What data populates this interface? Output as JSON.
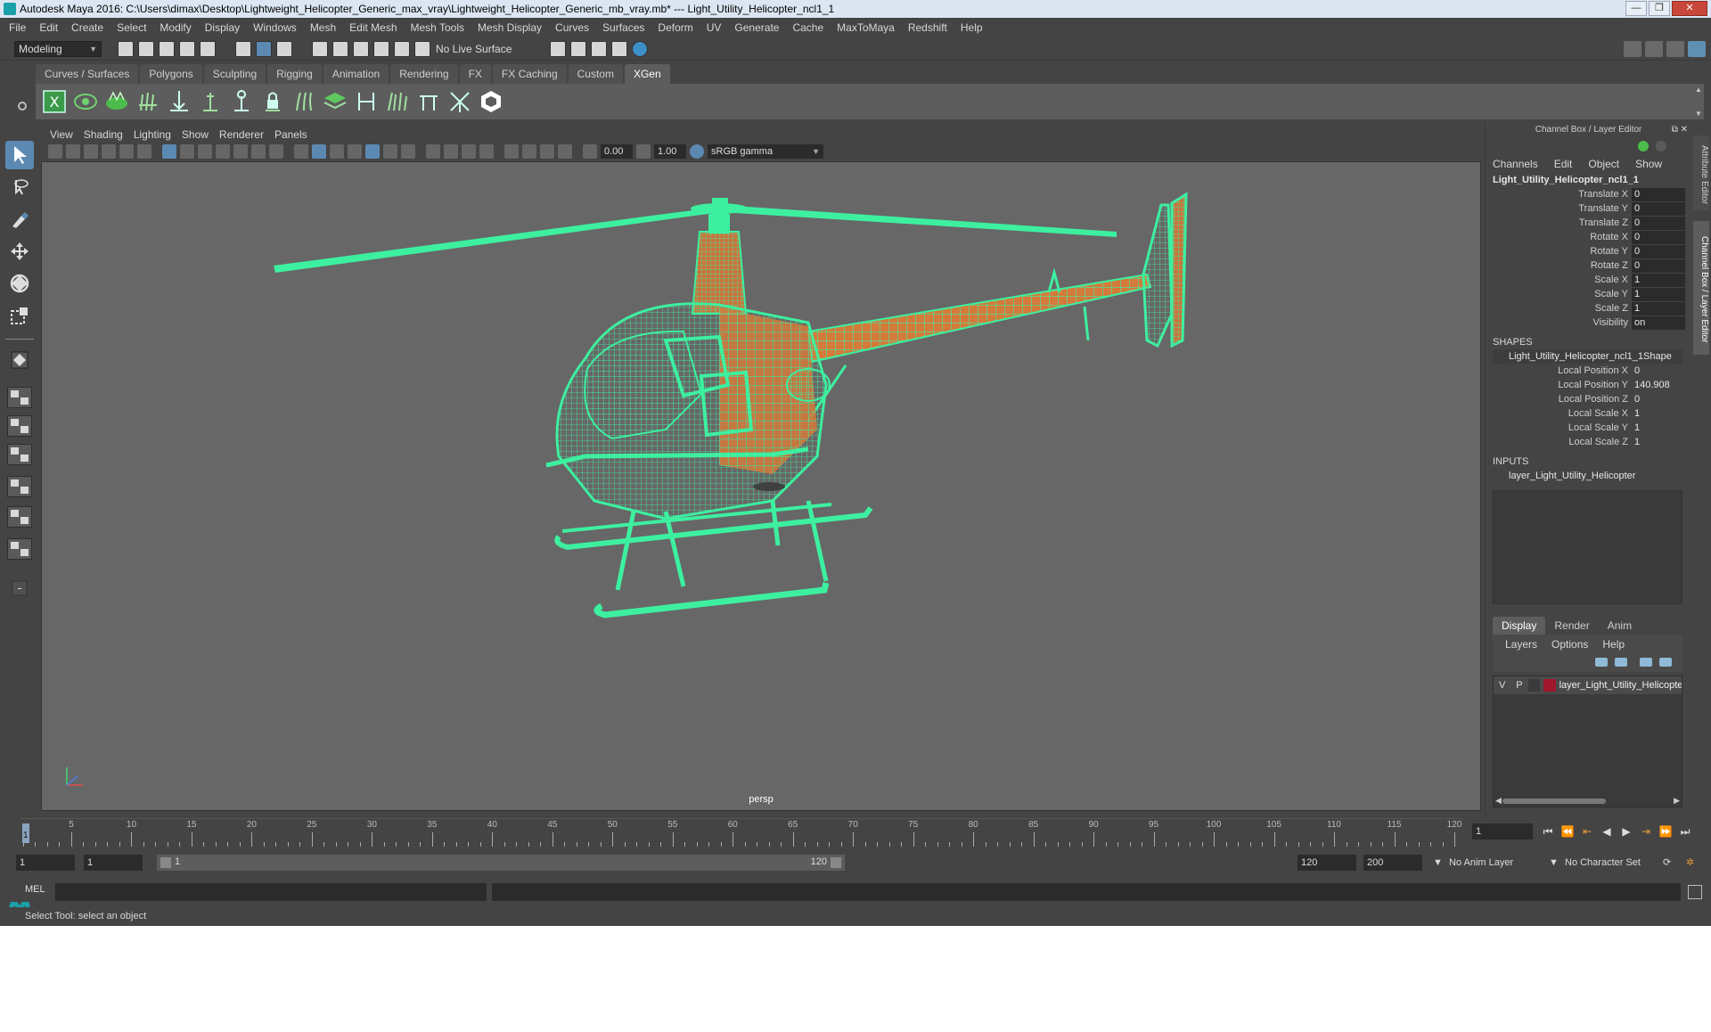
{
  "window": {
    "title": "Autodesk Maya 2016: C:\\Users\\dimax\\Desktop\\Lightweight_Helicopter_Generic_max_vray\\Lightweight_Helicopter_Generic_mb_vray.mb*   ---   Light_Utility_Helicopter_ncl1_1",
    "minimize": "—",
    "maximize": "❐",
    "close": "✕"
  },
  "menubar": [
    "File",
    "Edit",
    "Create",
    "Select",
    "Modify",
    "Display",
    "Windows",
    "Mesh",
    "Edit Mesh",
    "Mesh Tools",
    "Mesh Display",
    "Curves",
    "Surfaces",
    "Deform",
    "UV",
    "Generate",
    "Cache",
    "MaxToMaya",
    "Redshift",
    "Help"
  ],
  "statusline": {
    "mode": "Modeling",
    "live_surface": "No Live Surface"
  },
  "shelf_tabs": [
    {
      "label": "Curves / Surfaces",
      "active": false
    },
    {
      "label": "Polygons",
      "active": false
    },
    {
      "label": "Sculpting",
      "active": false
    },
    {
      "label": "Rigging",
      "active": false
    },
    {
      "label": "Animation",
      "active": false
    },
    {
      "label": "Rendering",
      "active": false
    },
    {
      "label": "FX",
      "active": false
    },
    {
      "label": "FX Caching",
      "active": false
    },
    {
      "label": "Custom",
      "active": false
    },
    {
      "label": "XGen",
      "active": true
    }
  ],
  "viewport": {
    "menu": [
      "View",
      "Shading",
      "Lighting",
      "Show",
      "Renderer",
      "Panels"
    ],
    "exposure": "0.00",
    "gamma_value": "1.00",
    "color_space": "sRGB gamma",
    "camera": "persp",
    "wire_color": "#3df0a0",
    "surface_color": "#d47a3a",
    "bg_color": "#676767"
  },
  "channel_box": {
    "title": "Channel Box / Layer Editor",
    "menu": [
      "Channels",
      "Edit",
      "Object",
      "Show"
    ],
    "object_name": "Light_Utility_Helicopter_ncl1_1",
    "channels": [
      {
        "label": "Translate X",
        "value": "0"
      },
      {
        "label": "Translate Y",
        "value": "0"
      },
      {
        "label": "Translate Z",
        "value": "0"
      },
      {
        "label": "Rotate X",
        "value": "0"
      },
      {
        "label": "Rotate Y",
        "value": "0"
      },
      {
        "label": "Rotate Z",
        "value": "0"
      },
      {
        "label": "Scale X",
        "value": "1"
      },
      {
        "label": "Scale Y",
        "value": "1"
      },
      {
        "label": "Scale Z",
        "value": "1"
      },
      {
        "label": "Visibility",
        "value": "on"
      }
    ],
    "shapes_title": "SHAPES",
    "shape_name": "Light_Utility_Helicopter_ncl1_1Shape",
    "shape_channels": [
      {
        "label": "Local Position X",
        "value": "0"
      },
      {
        "label": "Local Position Y",
        "value": "140.908"
      },
      {
        "label": "Local Position Z",
        "value": "0"
      },
      {
        "label": "Local Scale X",
        "value": "1"
      },
      {
        "label": "Local Scale Y",
        "value": "1"
      },
      {
        "label": "Local Scale Z",
        "value": "1"
      }
    ],
    "inputs_title": "INPUTS",
    "input_name": "layer_Light_Utility_Helicopter"
  },
  "layer_editor": {
    "tabs": [
      {
        "label": "Display",
        "active": true
      },
      {
        "label": "Render",
        "active": false
      },
      {
        "label": "Anim",
        "active": false
      }
    ],
    "menu": [
      "Layers",
      "Options",
      "Help"
    ],
    "layers": [
      {
        "v": "V",
        "p": "P",
        "name": "layer_Light_Utility_Helicopter",
        "color": "#a0162c"
      }
    ]
  },
  "side_tabs": [
    "Attribute Editor",
    "Channel Box / Layer Editor"
  ],
  "timeline": {
    "ticks": [
      "5",
      "10",
      "15",
      "20",
      "25",
      "30",
      "35",
      "40",
      "45",
      "50",
      "55",
      "60",
      "65",
      "70",
      "75",
      "80",
      "85",
      "90",
      "95",
      "100",
      "105",
      "110",
      "115",
      "120"
    ],
    "current_frame": "1",
    "current_frame_field": "1"
  },
  "range": {
    "start": "1",
    "playback_start": "1",
    "range_start_label": "1",
    "range_end_label": "120",
    "playback_end": "120",
    "end": "200",
    "anim_layer": "No Anim Layer",
    "character_set": "No Character Set"
  },
  "command_line": {
    "language": "MEL"
  },
  "help_line": "Select Tool: select an object"
}
